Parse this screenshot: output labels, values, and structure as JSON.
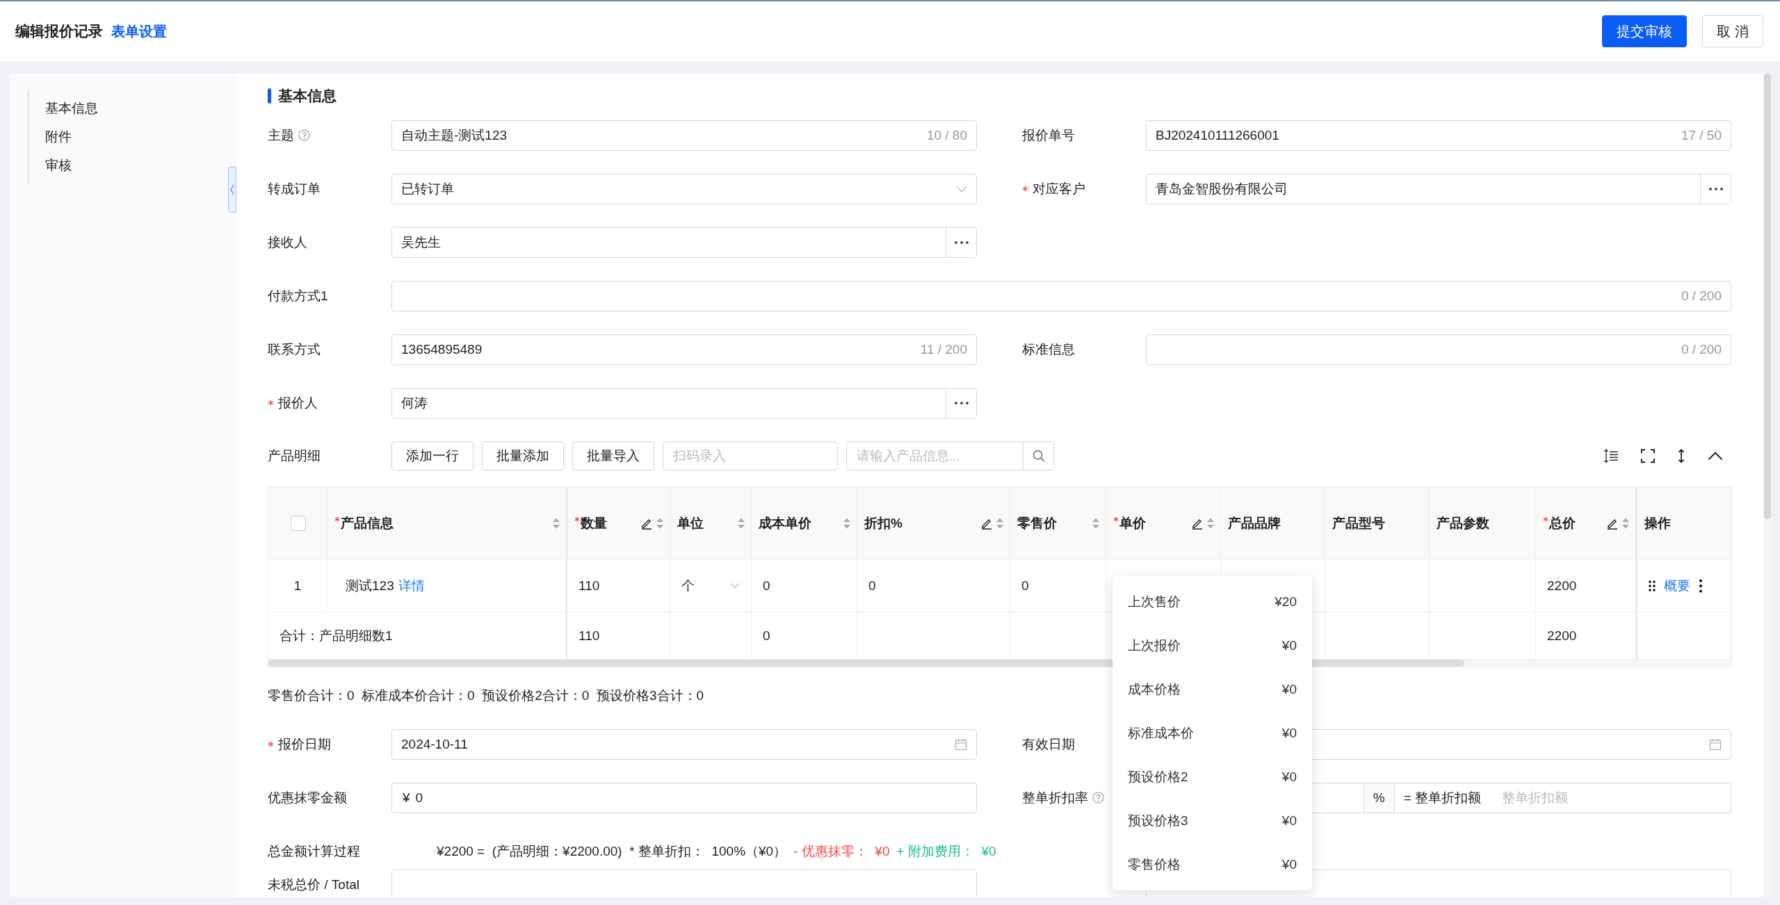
{
  "header": {
    "title": "编辑报价记录",
    "settings_link": "表单设置",
    "buttons": [
      {
        "label": "提交审核",
        "kind": "primary"
      },
      {
        "label": "取 消",
        "kind": "default"
      }
    ]
  },
  "sidebar": {
    "items": [
      {
        "label": "基本信息"
      },
      {
        "label": "附件"
      },
      {
        "label": "审核"
      }
    ]
  },
  "section_title": "基本信息",
  "form_rows": [
    [
      {
        "label": "主题",
        "help": true,
        "kind": "text",
        "value": "自动主题-测试123",
        "counter": "10 / 80"
      },
      {
        "label": "报价单号",
        "kind": "text",
        "value": "BJ202410111266001",
        "counter": "17 / 50"
      }
    ],
    [
      {
        "label": "转成订单",
        "kind": "select",
        "value": "已转订单"
      },
      {
        "label": "对应客户",
        "required": true,
        "kind": "picker",
        "value": "青岛金智股份有限公司"
      }
    ],
    [
      {
        "label": "接收人",
        "kind": "picker",
        "value": "吴先生"
      }
    ],
    [
      {
        "label": "付款方式1",
        "kind": "text",
        "counter": "0 / 200",
        "wide": true
      }
    ],
    [
      {
        "label": "联系方式",
        "kind": "text",
        "value": "13654895489",
        "counter": "11 / 200"
      },
      {
        "label": "标准信息",
        "kind": "text",
        "counter": "0 / 200"
      }
    ],
    [
      {
        "label": "报价人",
        "required": true,
        "kind": "picker",
        "value": "何涛"
      }
    ]
  ],
  "products": {
    "label": "产品明细",
    "buttons": [
      "添加一行",
      "批量添加",
      "批量导入"
    ],
    "scan_placeholder": "扫码录入",
    "search_placeholder": "请输入产品信息...",
    "table": {
      "columns": [
        {
          "kind": "checkbox",
          "checked": false
        },
        {
          "label": "产品信息",
          "required": true,
          "sortable": true
        },
        {
          "label": "数量",
          "required": true,
          "editable": true,
          "sortable": true
        },
        {
          "label": "单位",
          "sortable": true
        },
        {
          "label": "成本单价",
          "sortable": true
        },
        {
          "label": "折扣%",
          "editable": true,
          "sortable": true
        },
        {
          "label": "零售价",
          "sortable": true
        },
        {
          "label": "单价",
          "required": true,
          "editable": true,
          "sortable": true
        },
        {
          "label": "产品品牌"
        },
        {
          "label": "产品型号"
        },
        {
          "label": "产品参数"
        },
        {
          "label": "总价",
          "required": true,
          "editable": true,
          "sortable": true
        },
        {
          "label": "操作"
        }
      ],
      "rows": [
        {
          "cells": [
            {
              "kind": "index",
              "text": "1"
            },
            {
              "kind": "product",
              "text": "测试123",
              "link": "详情"
            },
            {
              "kind": "text",
              "text": "110"
            },
            {
              "kind": "select",
              "text": "个"
            },
            {
              "kind": "text",
              "text": "0"
            },
            {
              "kind": "text",
              "text": "0"
            },
            {
              "kind": "text",
              "text": "0"
            },
            {
              "kind": "text"
            },
            {
              "kind": "text"
            },
            {
              "kind": "text"
            },
            {
              "kind": "text"
            },
            {
              "kind": "text",
              "text": "2200"
            },
            {
              "kind": "actions",
              "link": "概要"
            }
          ]
        }
      ],
      "total_row": {
        "cells": [
          {
            "kind": "label",
            "text": "合计：产品明细数1"
          },
          {
            "kind": "text"
          },
          {
            "kind": "text",
            "text": "110"
          },
          {
            "kind": "text"
          },
          {
            "kind": "text",
            "text": "0"
          },
          {
            "kind": "text"
          },
          {
            "kind": "text"
          },
          {
            "kind": "text"
          },
          {
            "kind": "text"
          },
          {
            "kind": "text"
          },
          {
            "kind": "text"
          },
          {
            "kind": "text",
            "text": "2200"
          },
          {
            "kind": "text"
          }
        ]
      }
    },
    "summary": "零售价合计：0  标准成本价合计：0  预设价格2合计：0  预设价格3合计：0"
  },
  "form_rows_2": [
    [
      {
        "label": "报价日期",
        "required": true,
        "kind": "date",
        "value": "2024-10-11"
      },
      {
        "label": "有效日期",
        "kind": "date"
      }
    ],
    [
      {
        "label": "优惠抹零金额",
        "kind": "currency",
        "prefix": "¥",
        "value": "0"
      },
      {
        "label": "整单折扣率",
        "help": true,
        "kind": "discount",
        "suffix": "%",
        "amount_label": "= 整单折扣额",
        "amount_placeholder": "整单折扣额"
      }
    ]
  ],
  "calculation": {
    "label": "总金额计算过程",
    "parts": [
      {
        "color": "#222222",
        "text": "¥2200 =  (产品明细：¥2200.00)  * 整单折扣：  100%（¥0）"
      },
      {
        "color": "#f5484b",
        "text": "- 优惠抹零：  ¥0"
      },
      {
        "color": "#1bbd8b",
        "text": "+ 附加费用：  ¥0"
      }
    ]
  },
  "form_rows_3": [
    [
      {
        "label": "未税总价 / Total",
        "kind": "text"
      },
      {
        "kind": "text"
      }
    ]
  ],
  "price_popup": {
    "items": [
      {
        "label": "上次售价",
        "value": "¥20"
      },
      {
        "label": "上次报价",
        "value": "¥0"
      },
      {
        "label": "成本价格",
        "value": "¥0"
      },
      {
        "label": "标准成本价",
        "value": "¥0"
      },
      {
        "label": "预设价格2",
        "value": "¥0"
      },
      {
        "label": "预设价格3",
        "value": "¥0"
      },
      {
        "label": "零售价格",
        "value": "¥0"
      }
    ]
  }
}
